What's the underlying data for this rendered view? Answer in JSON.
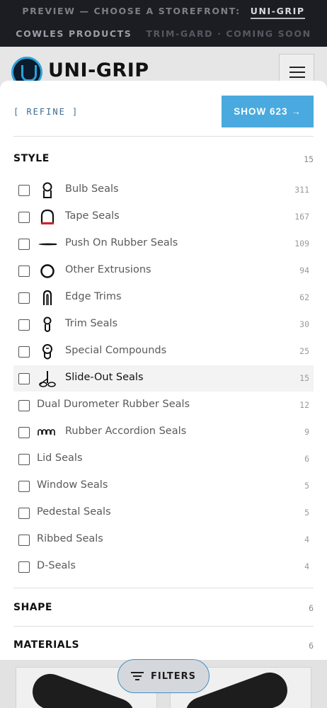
{
  "preview": {
    "prefix": "PREVIEW — CHOOSE A STOREFRONT:",
    "active_store": "UNI-GRIP",
    "store_cowles": "COWLES PRODUCTS",
    "store_trimgard": "TRIM-GARD · COMING SOON"
  },
  "header": {
    "logo_text": "UNI-GRIP"
  },
  "drawer": {
    "refine_label": "[ REFINE ]",
    "show_button": "SHOW 623 →",
    "style": {
      "title": "STYLE",
      "count": "15",
      "options": [
        {
          "label": "Bulb Seals",
          "count": "311",
          "icon": "bulb-seal-icon"
        },
        {
          "label": "Tape Seals",
          "count": "167",
          "icon": "tape-seal-icon"
        },
        {
          "label": "Push On Rubber Seals",
          "count": "109",
          "icon": "push-on-seal-icon"
        },
        {
          "label": "Other Extrusions",
          "count": "94",
          "icon": "extrusion-ring-icon"
        },
        {
          "label": "Edge Trims",
          "count": "62",
          "icon": "edge-trim-icon"
        },
        {
          "label": "Trim Seals",
          "count": "30",
          "icon": "trim-seal-icon"
        },
        {
          "label": "Special Compounds",
          "count": "25",
          "icon": "special-compound-icon"
        },
        {
          "label": "Slide-Out Seals",
          "count": "15",
          "icon": "slide-out-seal-icon"
        },
        {
          "label": "Dual Durometer Rubber Seals",
          "count": "12"
        },
        {
          "label": "Rubber Accordion Seals",
          "count": "9",
          "icon": "accordion-seal-icon"
        },
        {
          "label": "Lid Seals",
          "count": "6"
        },
        {
          "label": "Window Seals",
          "count": "5"
        },
        {
          "label": "Pedestal Seals",
          "count": "5"
        },
        {
          "label": "Ribbed Seals",
          "count": "4"
        },
        {
          "label": "D-Seals",
          "count": "4"
        }
      ]
    },
    "shape": {
      "title": "SHAPE",
      "count": "6"
    },
    "materials": {
      "title": "MATERIALS",
      "count": "6"
    }
  },
  "filters_button": "FILTERS",
  "colors": {
    "accent": "#4aa9de",
    "preview_bg": "#1b1d22",
    "tape_seal_red": "#d8202a"
  }
}
